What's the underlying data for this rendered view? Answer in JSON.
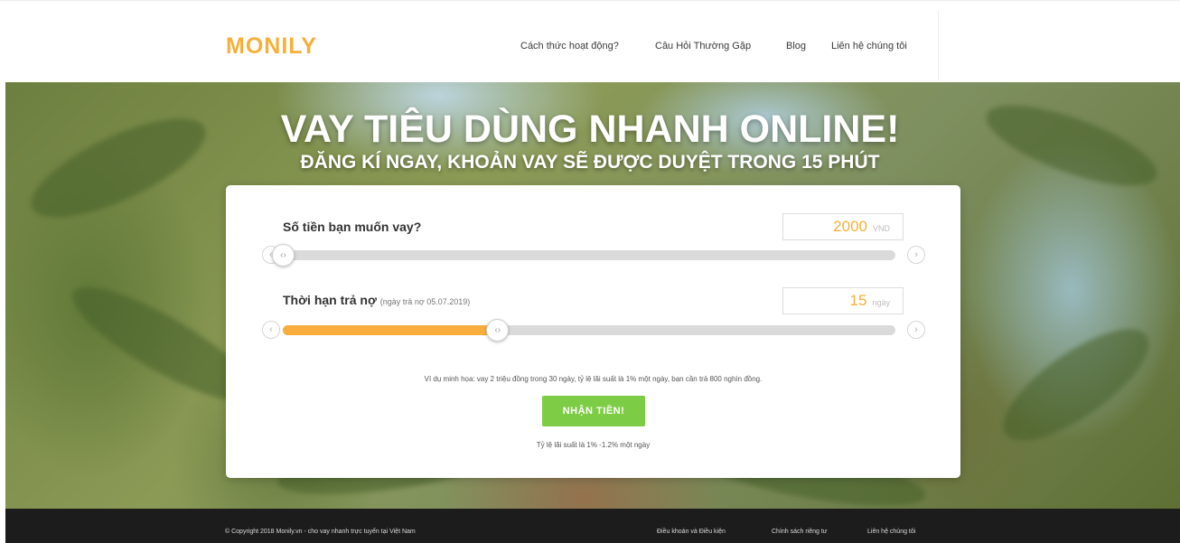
{
  "brand": {
    "logo": "MONILY",
    "accent": "#f6b03a"
  },
  "nav": {
    "items": [
      "Cách thức hoạt động?",
      "Câu Hỏi Thường Gặp",
      "Blog",
      "Liên hệ chúng tôi"
    ]
  },
  "hero": {
    "title": "VAY TIÊU DÙNG NHANH ONLINE!",
    "subtitle": "ĐĂNG KÍ NGAY, KHOẢN VAY SẼ ĐƯỢC DUYỆT TRONG 15 PHÚT"
  },
  "calculator": {
    "amount": {
      "label": "Số tiền bạn muốn vay?",
      "value": "2000",
      "unit": "VND",
      "slider_level": 0.0,
      "thumb_icon": "‹›",
      "prev_icon": "‹",
      "next_icon": "›"
    },
    "term": {
      "label": "Thời hạn trả nợ",
      "note": "(ngày trả nợ 05.07.2019)",
      "value": "15",
      "unit": "ngày",
      "slider_level": 0.35,
      "thumb_icon": "‹›",
      "prev_icon": "‹",
      "next_icon": "›"
    },
    "example": "Ví dụ minh họa: vay 2 triệu đồng trong 30 ngày, tỷ lệ lãi suất là 1% một ngày, bạn cần trả 800 nghìn đồng.",
    "cta_label": "NHẬN TIỀN!",
    "cta_color": "#7dcc45",
    "rate_note": "Tỷ lệ lãi suất là 1% -1.2% một ngày"
  },
  "footer": {
    "copyright": "© Copyright 2018 Monily.vn - cho vay nhanh trực tuyến tại Việt Nam",
    "links": [
      "Điều khoản và Điều kiện",
      "Chính sách riêng tư",
      "Liên hệ chúng tôi"
    ]
  }
}
